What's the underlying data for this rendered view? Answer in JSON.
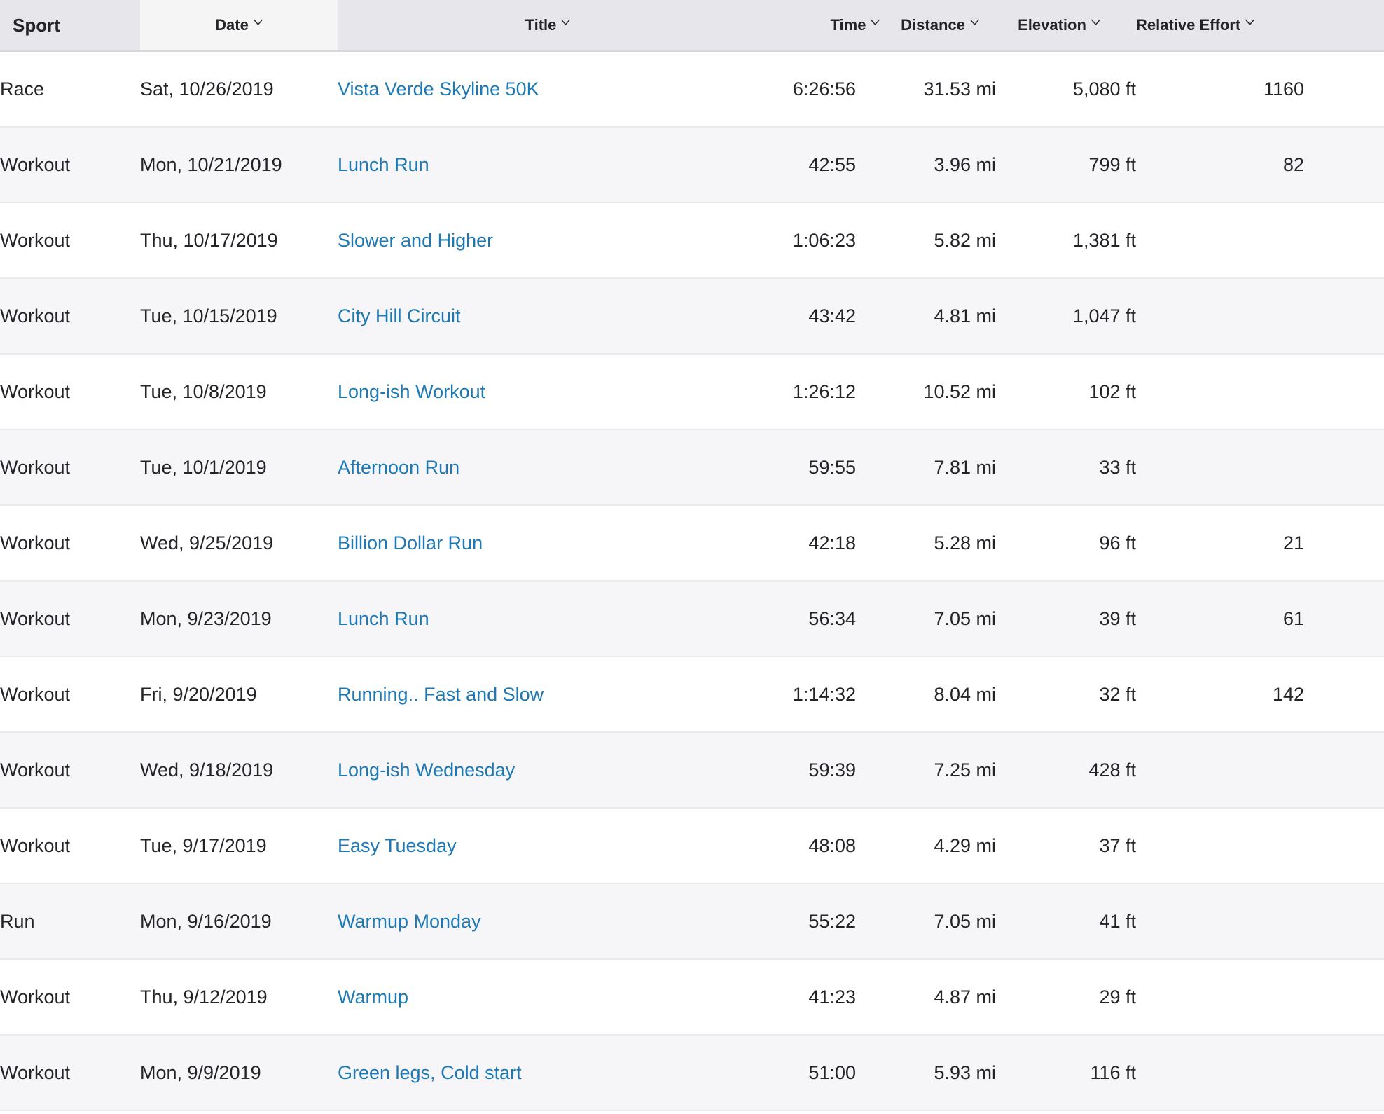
{
  "table": {
    "headers": {
      "sport": "Sport",
      "date": "Date",
      "title": "Title",
      "time": "Time",
      "distance": "Distance",
      "elevation": "Elevation",
      "relative_effort": "Relative Effort"
    },
    "sort_icon": "chevron-down-icon",
    "link_color": "#1d78b3",
    "rows": [
      {
        "sport": "Race",
        "date": "Sat, 10/26/2019",
        "title": "Vista Verde Skyline 50K",
        "time": "6:26:56",
        "distance": "31.53 mi",
        "elevation": "5,080 ft",
        "relative_effort": "1160"
      },
      {
        "sport": "Workout",
        "date": "Mon, 10/21/2019",
        "title": "Lunch Run",
        "time": "42:55",
        "distance": "3.96 mi",
        "elevation": "799 ft",
        "relative_effort": "82"
      },
      {
        "sport": "Workout",
        "date": "Thu, 10/17/2019",
        "title": "Slower and Higher",
        "time": "1:06:23",
        "distance": "5.82 mi",
        "elevation": "1,381 ft",
        "relative_effort": ""
      },
      {
        "sport": "Workout",
        "date": "Tue, 10/15/2019",
        "title": "City Hill Circuit",
        "time": "43:42",
        "distance": "4.81 mi",
        "elevation": "1,047 ft",
        "relative_effort": ""
      },
      {
        "sport": "Workout",
        "date": "Tue, 10/8/2019",
        "title": "Long-ish Workout",
        "time": "1:26:12",
        "distance": "10.52 mi",
        "elevation": "102 ft",
        "relative_effort": ""
      },
      {
        "sport": "Workout",
        "date": "Tue, 10/1/2019",
        "title": "Afternoon Run",
        "time": "59:55",
        "distance": "7.81 mi",
        "elevation": "33 ft",
        "relative_effort": ""
      },
      {
        "sport": "Workout",
        "date": "Wed, 9/25/2019",
        "title": "Billion Dollar Run",
        "time": "42:18",
        "distance": "5.28 mi",
        "elevation": "96 ft",
        "relative_effort": "21"
      },
      {
        "sport": "Workout",
        "date": "Mon, 9/23/2019",
        "title": "Lunch Run",
        "time": "56:34",
        "distance": "7.05 mi",
        "elevation": "39 ft",
        "relative_effort": "61"
      },
      {
        "sport": "Workout",
        "date": "Fri, 9/20/2019",
        "title": "Running.. Fast and Slow",
        "time": "1:14:32",
        "distance": "8.04 mi",
        "elevation": "32 ft",
        "relative_effort": "142"
      },
      {
        "sport": "Workout",
        "date": "Wed, 9/18/2019",
        "title": "Long-ish Wednesday",
        "time": "59:39",
        "distance": "7.25 mi",
        "elevation": "428 ft",
        "relative_effort": ""
      },
      {
        "sport": "Workout",
        "date": "Tue, 9/17/2019",
        "title": "Easy Tuesday",
        "time": "48:08",
        "distance": "4.29 mi",
        "elevation": "37 ft",
        "relative_effort": ""
      },
      {
        "sport": "Run",
        "date": "Mon, 9/16/2019",
        "title": "Warmup Monday",
        "time": "55:22",
        "distance": "7.05 mi",
        "elevation": "41 ft",
        "relative_effort": ""
      },
      {
        "sport": "Workout",
        "date": "Thu, 9/12/2019",
        "title": "Warmup",
        "time": "41:23",
        "distance": "4.87 mi",
        "elevation": "29 ft",
        "relative_effort": ""
      },
      {
        "sport": "Workout",
        "date": "Mon, 9/9/2019",
        "title": "Green legs, Cold start",
        "time": "51:00",
        "distance": "5.93 mi",
        "elevation": "116 ft",
        "relative_effort": ""
      }
    ]
  }
}
